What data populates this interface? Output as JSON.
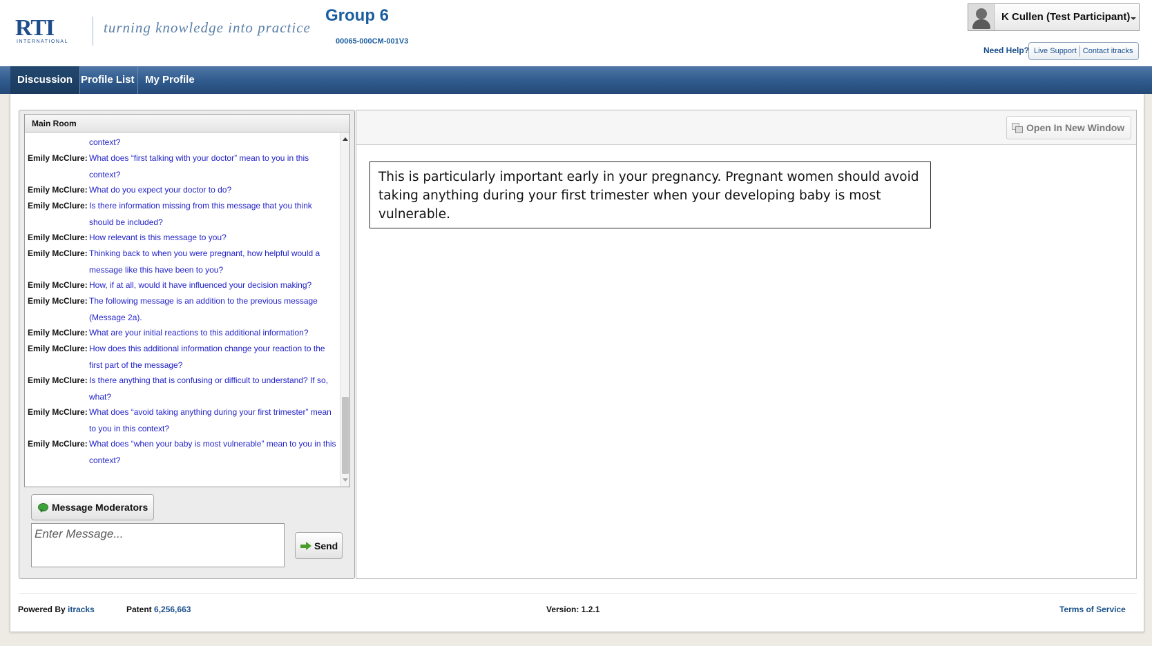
{
  "header": {
    "logo_text": "RTI",
    "logo_subtext": "INTERNATIONAL",
    "tagline": "turning knowledge into practice",
    "group_title": "Group 6",
    "group_code": "00065-000CM-001V3",
    "user_name": "K Cullen (Test Participant)",
    "need_help_label": "Need Help?",
    "live_support_label": "Live Support",
    "contact_label": "Contact itracks"
  },
  "nav": {
    "tabs": [
      {
        "label": "Discussion",
        "active": true
      },
      {
        "label": "Profile List",
        "active": false
      },
      {
        "label": "My Profile",
        "active": false
      }
    ]
  },
  "chat": {
    "room_title": "Main Room",
    "messages": [
      {
        "author": "",
        "text": "context?"
      },
      {
        "author": "Emily McClure:",
        "text": "What does “first talking with your doctor” mean to you in this context?"
      },
      {
        "author": "Emily McClure:",
        "text": "What do you expect your doctor to do?"
      },
      {
        "author": "Emily McClure:",
        "text": "Is there information missing from this message that you think should be included?"
      },
      {
        "author": "Emily McClure:",
        "text": "How relevant is this message to you?"
      },
      {
        "author": "Emily McClure:",
        "text": "Thinking back to when you were pregnant, how helpful would a message like this have been to you?"
      },
      {
        "author": "Emily McClure:",
        "text": "How, if at all, would it have influenced your decision making?"
      },
      {
        "author": "Emily McClure:",
        "text": "The following message is an addition to the previous message (Message 2a)."
      },
      {
        "author": "Emily McClure:",
        "text": "What are your initial reactions to this additional information?"
      },
      {
        "author": "Emily McClure:",
        "text": "How does this additional information change your reaction to the first part of the message?"
      },
      {
        "author": "Emily McClure:",
        "text": "Is there anything that is confusing or difficult to understand? If so, what?"
      },
      {
        "author": "Emily McClure:",
        "text": "What does “avoid taking anything during your first trimester” mean to you in this context?"
      },
      {
        "author": "Emily McClure:",
        "text": "What does “when your baby is most vulnerable” mean to you in this context?"
      }
    ],
    "moderators_button": "Message Moderators",
    "input_placeholder": "Enter Message...",
    "send_button": "Send"
  },
  "stimulus": {
    "open_window_button": "Open In New Window",
    "message_text": "This is particularly important early in your pregnancy. Pregnant women should avoid taking anything during your first trimester when your developing baby is most vulnerable."
  },
  "footer": {
    "powered_by_label": "Powered By",
    "powered_by_link": "itracks",
    "patent_label": "Patent",
    "patent_number": "6,256,663",
    "version_label": "Version: 1.2.1",
    "terms_label": "Terms of Service"
  },
  "colors": {
    "brand_blue": "#1a5d9e",
    "nav_blue": "#2f5a8c",
    "message_text_blue": "#2323c8"
  }
}
